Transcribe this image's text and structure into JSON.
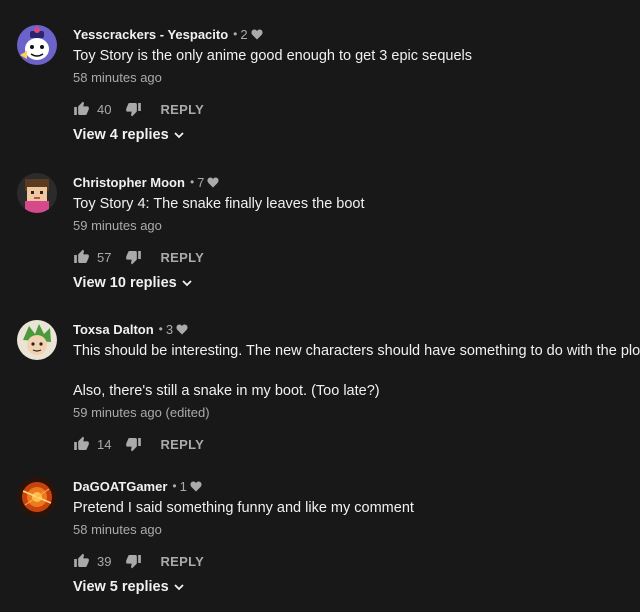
{
  "comments": [
    {
      "author": "Yesscrackers - Yespacito",
      "heart_count": "2",
      "lines": [
        "Toy Story is the only anime good enough to get 3 epic sequels"
      ],
      "timestamp": "58 minutes ago",
      "likes": "40",
      "reply_label": "REPLY",
      "view_replies": "View 4 replies"
    },
    {
      "author": "Christopher Moon",
      "heart_count": "7",
      "lines": [
        "Toy Story 4: The snake finally leaves the boot"
      ],
      "timestamp": "59 minutes ago",
      "likes": "57",
      "reply_label": "REPLY",
      "view_replies": "View 10 replies"
    },
    {
      "author": "Toxsa Dalton",
      "heart_count": "3",
      "lines": [
        "This should be interesting. The new characters should have something to do with the plot!",
        "Also, there's still a snake in my boot. (Too late?)"
      ],
      "timestamp": "59 minutes ago (edited)",
      "likes": "14",
      "reply_label": "REPLY"
    },
    {
      "author": "DaGOATGamer",
      "heart_count": "1",
      "lines": [
        "Pretend I said something funny and like my comment"
      ],
      "timestamp": "58 minutes ago",
      "likes": "39",
      "reply_label": "REPLY",
      "view_replies": "View 5 replies"
    }
  ],
  "colors": {
    "background": "#181818",
    "primary_text": "#f1f1f1",
    "secondary_text": "#aaaaaa",
    "icon": "#aaaaaa"
  },
  "icons": {
    "like": "thumb-up-icon",
    "dislike": "thumb-down-icon",
    "heart": "heart-icon",
    "expand": "chevron-down-icon"
  }
}
